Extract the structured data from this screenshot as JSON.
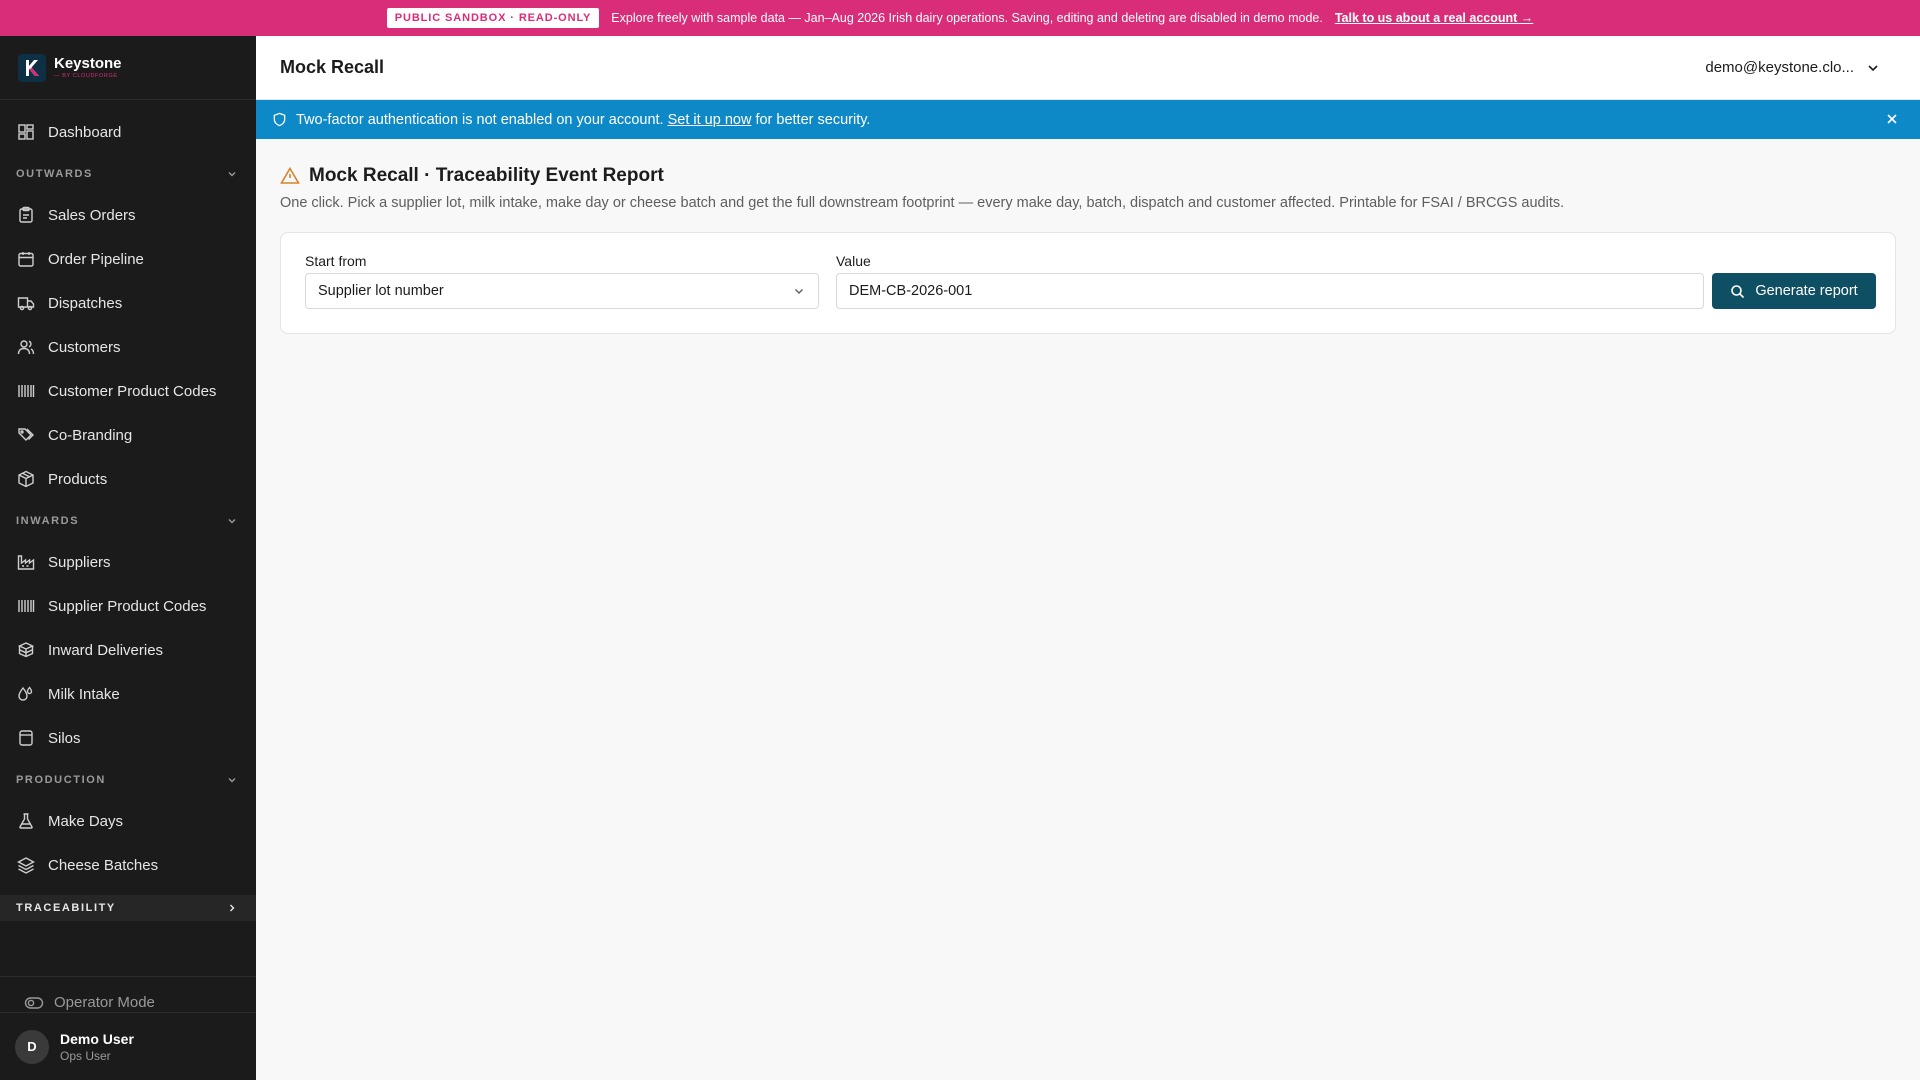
{
  "banner": {
    "badge": "PUBLIC SANDBOX · READ-ONLY",
    "text": "Explore freely with sample data — Jan–Aug 2026 Irish dairy operations. Saving, editing and deleting are disabled in demo mode.",
    "link": "Talk to us about a real account →",
    "color": "#d92d79"
  },
  "brand": {
    "name": "Keystone",
    "tagline": "— BY CLOUDFORGE"
  },
  "sidebar": {
    "items_top": [
      {
        "label": "Dashboard",
        "icon": "dashboard-icon"
      }
    ],
    "sections": [
      {
        "title": "OUTWARDS",
        "items": [
          {
            "label": "Sales Orders",
            "icon": "clipboard-icon"
          },
          {
            "label": "Order Pipeline",
            "icon": "calendar-icon"
          },
          {
            "label": "Dispatches",
            "icon": "truck-icon"
          },
          {
            "label": "Customers",
            "icon": "users-icon"
          },
          {
            "label": "Customer Product Codes",
            "icon": "barcode-icon"
          },
          {
            "label": "Co-Branding",
            "icon": "tags-icon"
          },
          {
            "label": "Products",
            "icon": "package-icon"
          }
        ]
      },
      {
        "title": "INWARDS",
        "items": [
          {
            "label": "Suppliers",
            "icon": "factory-icon"
          },
          {
            "label": "Supplier Product Codes",
            "icon": "barcode-icon"
          },
          {
            "label": "Inward Deliveries",
            "icon": "boxes-icon"
          },
          {
            "label": "Milk Intake",
            "icon": "droplets-icon"
          },
          {
            "label": "Silos",
            "icon": "cylinder-icon"
          }
        ]
      },
      {
        "title": "PRODUCTION",
        "items": [
          {
            "label": "Make Days",
            "icon": "flask-icon"
          },
          {
            "label": "Cheese Batches",
            "icon": "layers-icon"
          }
        ]
      },
      {
        "title": "TRACEABILITY",
        "items": []
      }
    ],
    "operator_mode": "Operator Mode",
    "user": {
      "initial": "D",
      "name": "Demo User",
      "role": "Ops User"
    }
  },
  "header": {
    "title": "Mock Recall",
    "account": "demo@keystone.clo..."
  },
  "notice": {
    "text_before": "Two-factor authentication is not enabled on your account.",
    "link": "Set it up now",
    "text_after": "for better security.",
    "color": "#0e89c8"
  },
  "page": {
    "title": "Mock Recall · Traceability Event Report",
    "description": "One click. Pick a supplier lot, milk intake, make day or cheese batch and get the full downstream footprint — every make day, batch, dispatch and customer affected. Printable for FSAI / BRCGS audits.",
    "start_from_label": "Start from",
    "start_from_value": "Supplier lot number",
    "value_label": "Value",
    "value": "DEM-CB-2026-001",
    "button": "Generate report",
    "accent": "#0f4f64"
  }
}
